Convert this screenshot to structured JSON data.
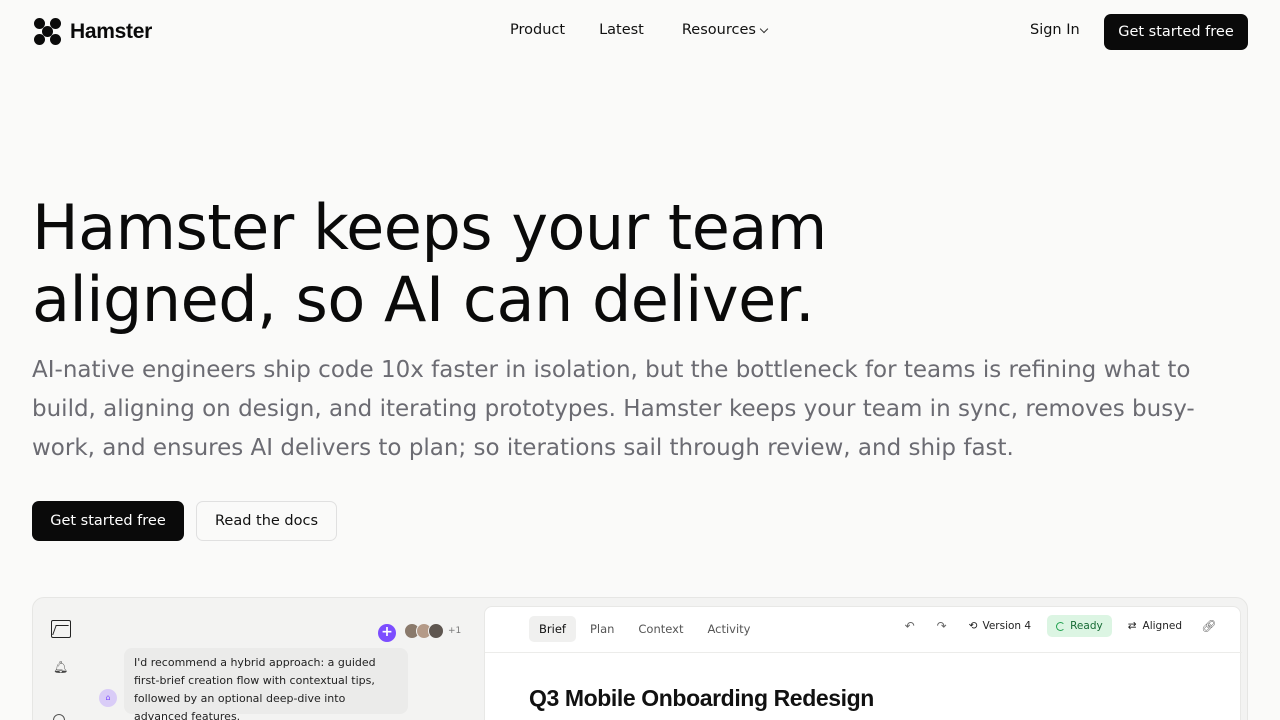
{
  "brand": {
    "name": "Hamster"
  },
  "nav": {
    "links": [
      {
        "label": "Product"
      },
      {
        "label": "Latest"
      },
      {
        "label": "Resources"
      }
    ],
    "signin_label": "Sign In",
    "cta_label": "Get started free"
  },
  "hero": {
    "title_line1": "Hamster keeps your team",
    "title_line2": "aligned, so AI can deliver.",
    "subtitle": "AI-native engineers ship code 10x faster in isolation, but the bottleneck for teams is refining what to build, aligning on design, and iterating prototypes. Hamster keeps your team in sync, removes busy-work, and ensures AI delivers to plan; so iterations sail through review, and ship fast.",
    "primary_cta": "Get started free",
    "secondary_cta": "Read the docs"
  },
  "preview": {
    "avatars_more": "+1",
    "chat_text": "I'd recommend a hybrid approach: a guided first-brief creation flow with contextual tips, followed by an optional deep-dive into advanced features.",
    "tabs": [
      {
        "label": "Brief",
        "active": true
      },
      {
        "label": "Plan"
      },
      {
        "label": "Context"
      },
      {
        "label": "Activity"
      }
    ],
    "version_label": "Version 4",
    "status_label": "Ready",
    "aligned_label": "Aligned",
    "doc_title": "Q3 Mobile Onboarding Redesign",
    "colors": {
      "accent": "#7c4dff",
      "ready_bg": "#dcf5e3",
      "ready_text": "#176b35"
    }
  }
}
